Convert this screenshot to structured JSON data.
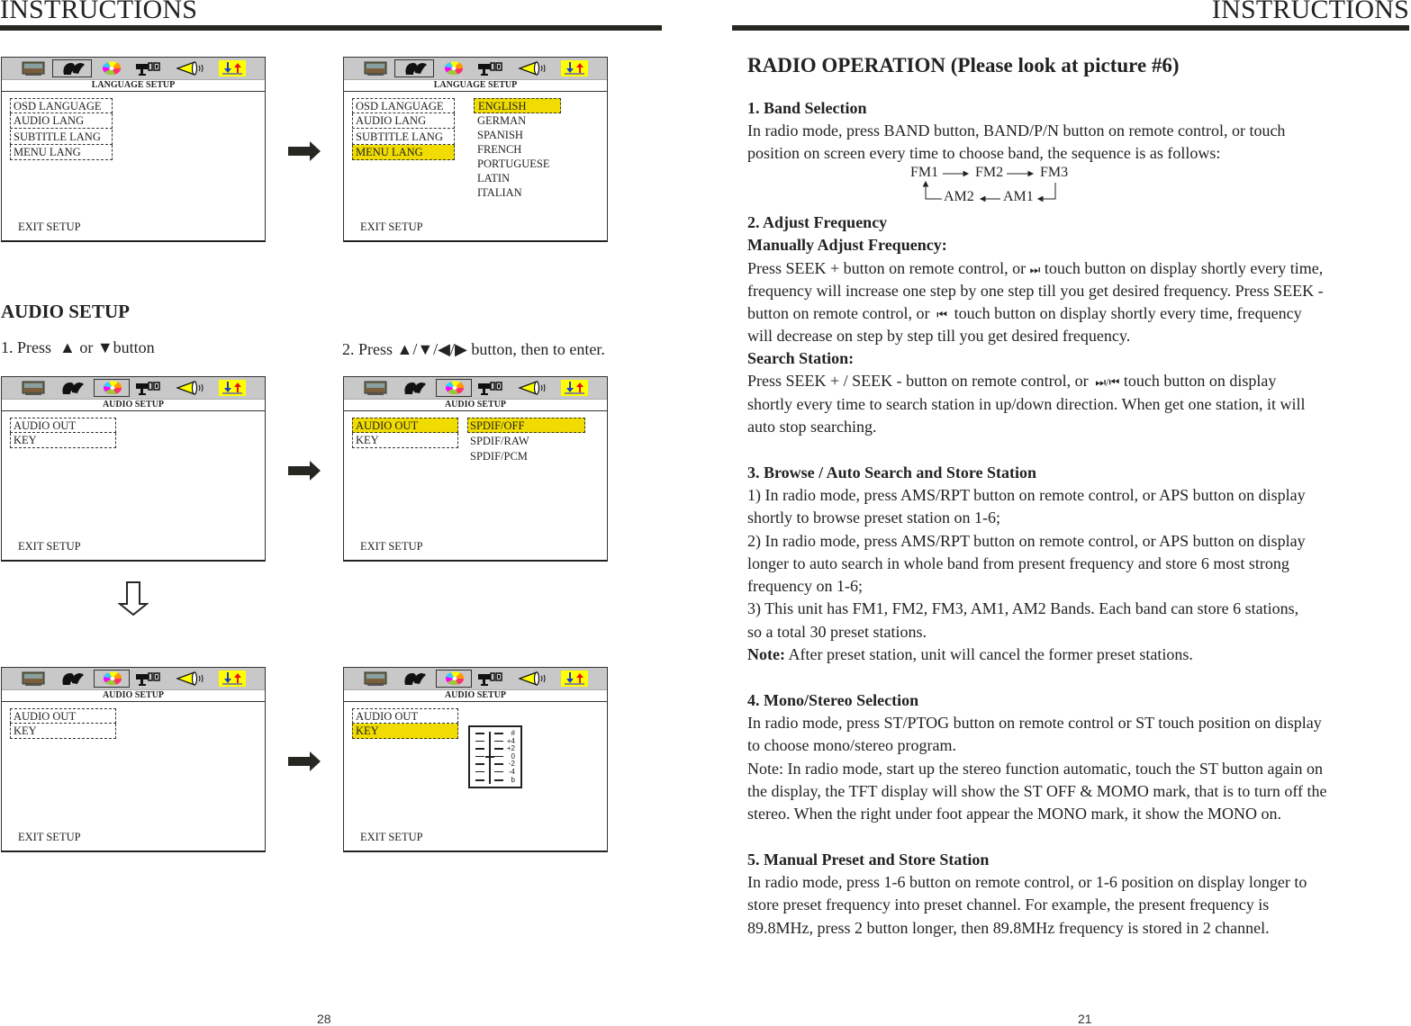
{
  "left_page": {
    "header": "INSTRUCTIONS",
    "page_number": "28",
    "screens": {
      "lang_1": {
        "title": "LANGUAGE SETUP",
        "items": [
          "OSD LANGUAGE",
          "AUDIO LANG",
          "SUBTITLE LANG",
          "MENU LANG"
        ],
        "exit": "EXIT SETUP"
      },
      "lang_2": {
        "title": "LANGUAGE SETUP",
        "items": [
          "OSD LANGUAGE",
          "AUDIO LANG",
          "SUBTITLE LANG",
          "MENU LANG"
        ],
        "highlighted_item": "MENU LANG",
        "options": [
          "ENGLISH",
          "GERMAN",
          "SPANISH",
          "FRENCH",
          "PORTUGUESE",
          "LATIN",
          "ITALIAN"
        ],
        "highlighted_option": "ENGLISH",
        "exit": "EXIT SETUP"
      },
      "audio_1": {
        "title": "AUDIO SETUP",
        "items": [
          "AUDIO OUT",
          "KEY"
        ],
        "exit": "EXIT SETUP"
      },
      "audio_2": {
        "title": "AUDIO SETUP",
        "items": [
          "AUDIO OUT",
          "KEY"
        ],
        "highlighted_item": "AUDIO OUT",
        "options": [
          "SPDIF/OFF",
          "SPDIF/RAW",
          "SPDIF/PCM"
        ],
        "highlighted_option": "SPDIF/OFF",
        "exit": "EXIT SETUP"
      },
      "audio_3": {
        "title": "AUDIO SETUP",
        "items": [
          "AUDIO OUT",
          "KEY"
        ],
        "exit": "EXIT SETUP"
      },
      "audio_4": {
        "title": "AUDIO SETUP",
        "items": [
          "AUDIO OUT",
          "KEY"
        ],
        "highlighted_item": "KEY",
        "key_scale": [
          "#",
          "+4",
          "+2",
          "0",
          "-2",
          "-4",
          "b"
        ],
        "key_value": "0",
        "exit": "EXIT SETUP"
      }
    },
    "icon_bar": [
      "tv-picture-icon",
      "language-people-icon",
      "audio-disc-icon",
      "video-camera-icon",
      "speaker-icon",
      "preference-arrows-icon"
    ],
    "audio_setup": {
      "heading": "AUDIO SETUP",
      "step1_prefix": "1. Press",
      "step1_mid": "or",
      "step1_suffix": "button",
      "step2_prefix": "2. Press",
      "step2_suffix": "button, then to enter."
    },
    "colors": {
      "highlight": "#f0dc00",
      "iconbar": "#c8c8c8",
      "rule": "#272722"
    }
  },
  "right_page": {
    "header": "INSTRUCTIONS",
    "page_number": "21",
    "title": "RADIO OPERATION (Please look at picture #6)",
    "s1": {
      "heading": "1. Band Selection",
      "lines": [
        "In radio mode, press BAND button, BAND/P/N button on remote control, or touch",
        "position on screen every time to choose band, the sequence is as follows:"
      ],
      "sequence_top": [
        "FM1",
        "FM2",
        "FM3"
      ],
      "sequence_bottom": [
        "AM2",
        "AM1"
      ]
    },
    "s2": {
      "heading": "2. Adjust Frequency",
      "sub1": "Manually Adjust Frequency:",
      "l1a": "Press SEEK + button on remote control, or",
      "l1b": "touch button on display shortly every time,",
      "l2": "frequency will increase one step by one step till you get desired frequency. Press SEEK -",
      "l3a": "button on remote control, or",
      "l3b": "touch button on display shortly every time, frequency",
      "l4": "will decrease on step by step till you get desired frequency.",
      "sub2": "Search Station:",
      "l5a": "Press SEEK + / SEEK - button on remote control, or",
      "l5b": "touch button on display",
      "l6": "shortly every time to search station in up/down direction. When get one station, it will",
      "l7": "auto stop searching."
    },
    "s3": {
      "heading": "3. Browse / Auto Search and Store Station",
      "lines": [
        "1) In radio mode, press AMS/RPT button on remote control, or APS button on display",
        "shortly to browse preset station on 1-6;",
        "2) In radio mode, press AMS/RPT button on remote control, or APS button on display",
        "longer to auto search in whole band from present frequency and store 6 most strong",
        "frequency on 1-6;",
        "3) This unit has FM1, FM2, FM3, AM1, AM2 Bands. Each band can store 6 stations,",
        "so a total 30 preset stations."
      ],
      "note_label": "Note:",
      "note_text": " After preset station, unit will cancel the former preset stations."
    },
    "s4": {
      "heading": "4. Mono/Stereo Selection",
      "lines": [
        "In radio mode, press ST/PTOG button on remote control or ST touch position on display",
        "to choose mono/stereo program.",
        "Note: In radio mode, start up the stereo function automatic, touch the ST button again on",
        " the display, the TFT display will show the ST OFF & MOMO mark, that is to turn off the",
        "stereo. When the right under foot appear the MONO mark, it show the MONO on."
      ]
    },
    "s5": {
      "heading": "5.  Manual Preset and Store Station",
      "lines": [
        "In radio mode, press 1-6 button on remote control, or 1-6 position on display longer to",
        "store preset frequency into preset channel. For example, the present frequency is",
        "89.8MHz, press 2 button longer, then 89.8MHz frequency is stored in 2 channel."
      ]
    }
  }
}
